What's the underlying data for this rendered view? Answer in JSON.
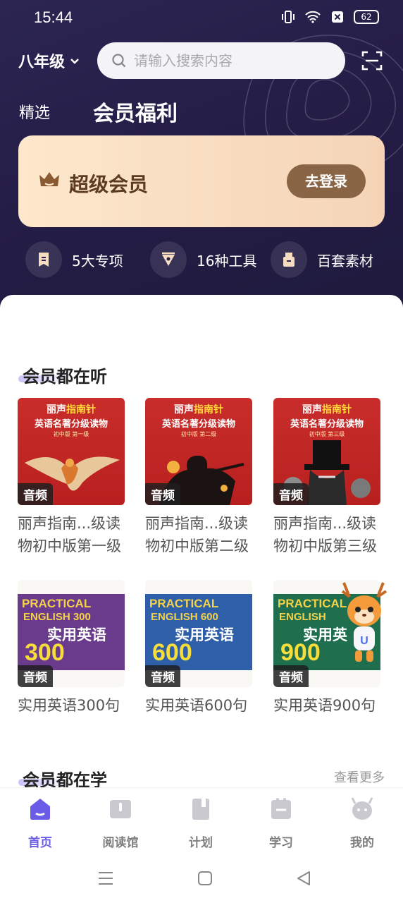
{
  "status": {
    "time": "15:44",
    "battery": "62"
  },
  "header": {
    "grade": "八年级",
    "search_placeholder": "请输入搜索内容",
    "tab_featured": "精选",
    "tab_member": "会员福利"
  },
  "vip": {
    "title": "超级会员",
    "login_label": "去登录"
  },
  "perks": [
    {
      "label": "5大专项",
      "icon": "bookmark-icon"
    },
    {
      "label": "16种工具",
      "icon": "pen-icon"
    },
    {
      "label": "百套素材",
      "icon": "usb-icon"
    }
  ],
  "listen": {
    "title": "会员都在听",
    "books": [
      {
        "title": "丽声指南...级读物初中版第一级",
        "badge": "音频",
        "cover": {
          "brand": "丽声",
          "brand_hl": "指南针",
          "subtitle": "英语名著分级读物",
          "level": "初中版 第一级"
        }
      },
      {
        "title": "丽声指南...级读物初中版第二级",
        "badge": "音频",
        "cover": {
          "brand": "丽声",
          "brand_hl": "指南针",
          "subtitle": "英语名著分级读物",
          "level": "初中版 第二级"
        }
      },
      {
        "title": "丽声指南...级读物初中版第三级",
        "badge": "音频",
        "cover": {
          "brand": "丽声",
          "brand_hl": "指南针",
          "subtitle": "英语名著分级读物",
          "level": "初中版 第三级"
        }
      },
      {
        "title": "实用英语300句",
        "badge": "音频",
        "cover": {
          "line1": "PRACTICAL",
          "line2": "ENGLISH 300",
          "cn": "实用英语",
          "num": "300"
        }
      },
      {
        "title": "实用英语600句",
        "badge": "音频",
        "cover": {
          "line1": "PRACTICAL",
          "line2": "ENGLISH 600",
          "cn": "实用英语",
          "num": "600"
        }
      },
      {
        "title": "实用英语900句",
        "badge": "音频",
        "cover": {
          "line1": "PRACTICAL",
          "line2": "ENGLISH",
          "cn": "实用英",
          "num": "900"
        }
      }
    ]
  },
  "study": {
    "title": "会员都在学",
    "more_label": "查看更多"
  },
  "tabbar": [
    {
      "label": "首页",
      "active": true
    },
    {
      "label": "阅读馆",
      "active": false
    },
    {
      "label": "计划",
      "active": false
    },
    {
      "label": "学习",
      "active": false
    },
    {
      "label": "我的",
      "active": false
    }
  ],
  "colors": {
    "accent": "#6b5ce7",
    "hero_bg": "#261f4a",
    "vip_btn": "#8a6545",
    "cover_red": "#c0272a",
    "pe_purple": "#6a3a8c",
    "pe_blue": "#2f5fa8",
    "pe_green": "#1f6f4f"
  }
}
